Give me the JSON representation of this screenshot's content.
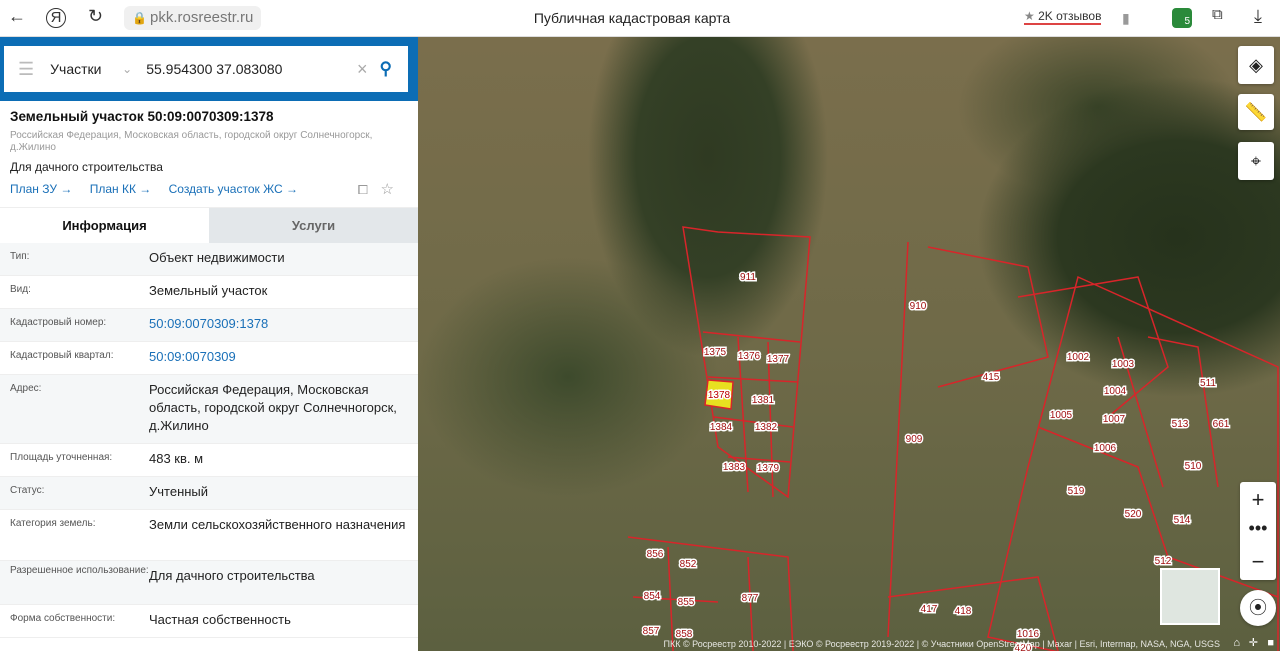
{
  "browser": {
    "url": "pkk.rosreestr.ru",
    "title": "Публичная кадастровая карта",
    "reviews": "2K отзывов",
    "ext_badge": "5"
  },
  "search": {
    "category": "Участки",
    "query": "55.954300 37.083080"
  },
  "card": {
    "title": "Земельный участок 50:09:0070309:1378",
    "address": "Российская Федерация, Московская область, городской округ Солнечногорск, д.Жилино",
    "use": "Для дачного строительства",
    "links": [
      "План ЗУ →",
      "План КК →",
      "Создать участок ЖС →"
    ]
  },
  "tabs": [
    {
      "label": "Информация"
    },
    {
      "label": "Услуги"
    }
  ],
  "info": [
    {
      "k": "Тип:",
      "v": "Объект недвижимости"
    },
    {
      "k": "Вид:",
      "v": "Земельный участок"
    },
    {
      "k": "Кадастровый номер:",
      "v": "50:09:0070309:1378"
    },
    {
      "k": "Кадастровый квартал:",
      "v": "50:09:0070309"
    },
    {
      "k": "Адрес:",
      "v": "Российская Федерация, Московская область, городской округ Солнечногорск, д.Жилино"
    },
    {
      "k": "Площадь уточненная:",
      "v": "483 кв. м"
    },
    {
      "k": "Статус:",
      "v": "Учтенный"
    },
    {
      "k": "Категория земель:",
      "v": "Земли сельскохозяйственного назначения"
    },
    {
      "k": "Разрешенное использование:",
      "v": "Для дачного строительства"
    },
    {
      "k": "Форма собственности:",
      "v": "Частная собственность"
    }
  ],
  "map": {
    "selected": "1378",
    "parcels": [
      "911",
      "1375",
      "1376",
      "1377",
      "1381",
      "1384",
      "1382",
      "1383",
      "1379",
      "910",
      "909",
      "415",
      "1002",
      "1003",
      "1004",
      "1005",
      "1007",
      "1006",
      "511",
      "513",
      "661",
      "510",
      "519",
      "520",
      "514",
      "512",
      "856",
      "852",
      "854",
      "855",
      "877",
      "857",
      "858",
      "417",
      "418",
      "1016",
      "420"
    ],
    "attribution": "ПКК © Росреестр 2010-2022 | ЕЭКО © Росреестр 2019-2022 | © Участники OpenStreetMap | Maxar | Esri, Intermap, NASA, NGA, USGS",
    "colors": {
      "parcel": "#d8252a",
      "selected": "#e8e020",
      "accent": "#0c6db5"
    }
  }
}
